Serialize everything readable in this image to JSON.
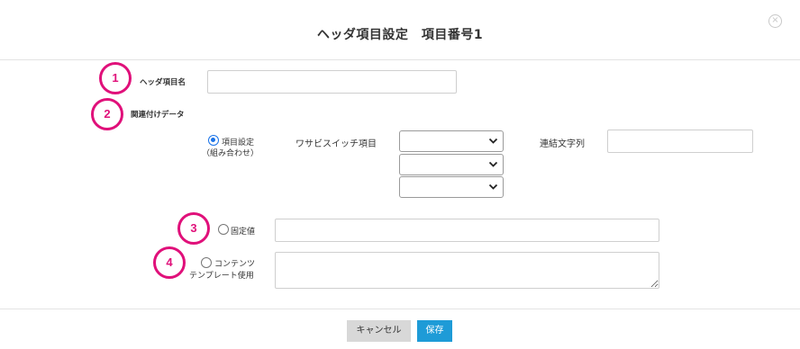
{
  "dialog": {
    "title": "ヘッダ項目設定　項目番号1",
    "close_icon": "close-circle-icon"
  },
  "fields": {
    "header_name_label": "ヘッダ項目名",
    "header_name_value": "",
    "related_data_label": "関連付けデータ",
    "item_setting_label": "項目設定",
    "item_setting_sub": "（組み合わせ）",
    "wasabi_switch_label": "ワサビスイッチ項目",
    "select_values": [
      "",
      "",
      ""
    ],
    "concat_label": "連結文字列",
    "concat_value": "",
    "fixed_value_label": "固定値",
    "fixed_value_value": "",
    "contents_label_1": "コンテンツ",
    "contents_label_2": "テンプレート使用",
    "contents_value": ""
  },
  "markers": [
    "1",
    "2",
    "3",
    "4"
  ],
  "buttons": {
    "cancel": "キャンセル",
    "save": "保存"
  },
  "colors": {
    "accent": "#1e9bd7",
    "marker": "#e0107a",
    "radio_selected": "#1a73e8"
  }
}
